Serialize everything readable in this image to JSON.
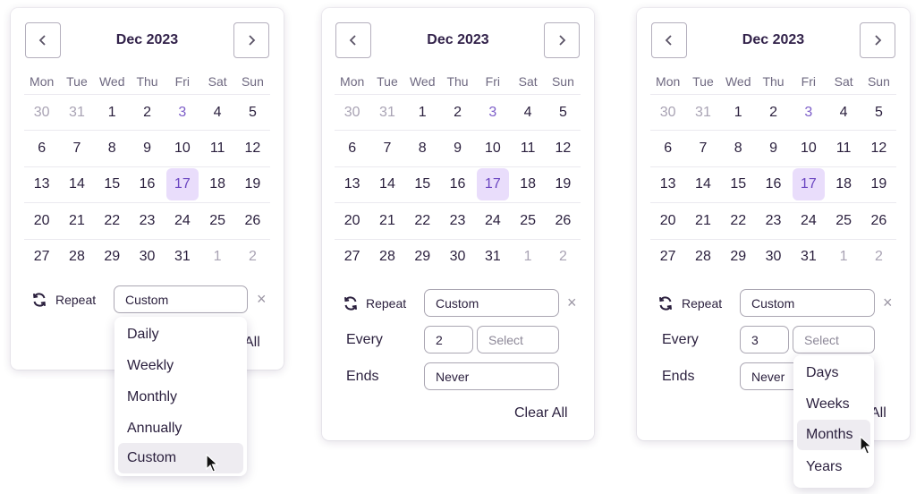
{
  "calendar": {
    "month_label": "Dec 2023",
    "weekdays": [
      "Mon",
      "Tue",
      "Wed",
      "Thu",
      "Fri",
      "Sat",
      "Sun"
    ],
    "days": [
      "30",
      "31",
      "1",
      "2",
      "3",
      "4",
      "5",
      "6",
      "7",
      "8",
      "9",
      "10",
      "11",
      "12",
      "13",
      "14",
      "15",
      "16",
      "17",
      "18",
      "19",
      "20",
      "21",
      "22",
      "23",
      "24",
      "25",
      "26",
      "27",
      "28",
      "29",
      "30",
      "31",
      "1",
      "2"
    ],
    "selected_day": "17",
    "accent_color": "#6b46c1"
  },
  "icons": {
    "prev": "chevron-left-icon",
    "next": "chevron-right-icon",
    "repeat": "refresh-icon",
    "clear": "close-icon",
    "cursor": "mouse-pointer-icon"
  },
  "panel1": {
    "repeat_label": "Repeat",
    "repeat_value": "Custom",
    "clear_x": "×",
    "clear_all_partial": "All",
    "dropdown": [
      "Daily",
      "Weekly",
      "Monthly",
      "Annually",
      "Custom"
    ],
    "hovered": "Custom"
  },
  "panel2": {
    "repeat_label": "Repeat",
    "repeat_value": "Custom",
    "clear_x": "×",
    "every_label": "Every",
    "every_value": "2",
    "unit_placeholder": "Select",
    "ends_label": "Ends",
    "ends_value": "Never",
    "clear_all": "Clear All"
  },
  "panel3": {
    "repeat_label": "Repeat",
    "repeat_value": "Custom",
    "clear_x": "×",
    "every_label": "Every",
    "every_value": "3",
    "unit_placeholder": "Select",
    "ends_label": "Ends",
    "ends_value": "Never",
    "clear_all_partial": "All",
    "dropdown": [
      "Days",
      "Weeks",
      "Months",
      "Years"
    ],
    "hovered": "Months"
  }
}
